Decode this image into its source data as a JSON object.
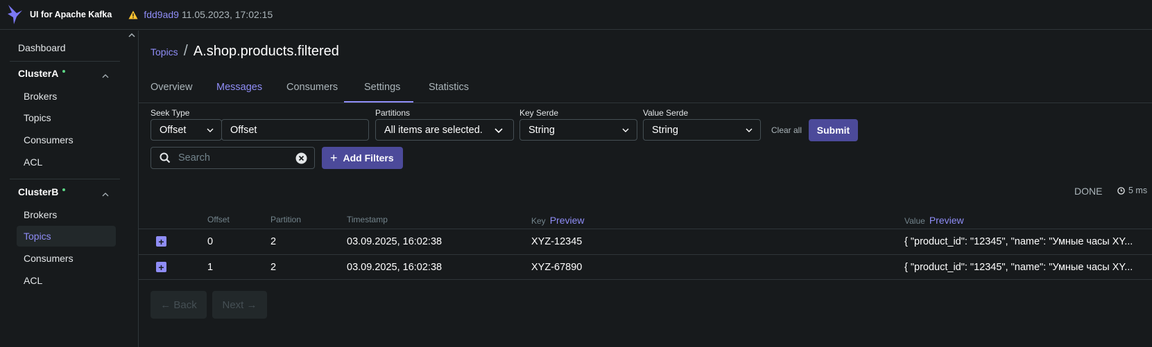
{
  "app": {
    "name": "UI for Apache Kafka",
    "commit": "fdd9ad9",
    "build_date": "11.05.2023, 17:02:15",
    "accent_color": "#8f8df7",
    "button_color": "#4c4a9a",
    "warning_color": "#ffc430",
    "online_dot_color": "#5cd685"
  },
  "sidebar": {
    "dashboard": "Dashboard",
    "clusters": [
      {
        "name": "ClusterA",
        "items": [
          "Brokers",
          "Topics",
          "Consumers",
          "ACL"
        ]
      },
      {
        "name": "ClusterB",
        "items": [
          "Brokers",
          "Topics",
          "Consumers",
          "ACL"
        ],
        "active_item": "Topics"
      }
    ]
  },
  "breadcrumb": {
    "parent": "Topics",
    "separator": "/",
    "title": "A.shop.products.filtered"
  },
  "tabs": [
    {
      "label": "Overview"
    },
    {
      "label": "Messages",
      "active": true
    },
    {
      "label": "Consumers"
    },
    {
      "label": "Settings"
    },
    {
      "label": "Statistics"
    }
  ],
  "filters": {
    "seek_type_label": "Seek Type",
    "seek_type_value": "Offset",
    "seek_input_value": "Offset",
    "partitions_label": "Partitions",
    "partitions_value": "All items are selected.",
    "key_serde_label": "Key Serde",
    "key_serde_value": "String",
    "value_serde_label": "Value Serde",
    "value_serde_value": "String",
    "clear_all": "Clear all",
    "submit": "Submit",
    "search_placeholder": "Search",
    "add_filters": "Add Filters"
  },
  "status": {
    "state": "DONE",
    "elapsed": "5 ms"
  },
  "table": {
    "headers": {
      "offset": "Offset",
      "partition": "Partition",
      "timestamp": "Timestamp",
      "key": "Key",
      "value": "Value",
      "preview": "Preview"
    },
    "rows": [
      {
        "offset": "0",
        "partition": "2",
        "timestamp": "03.09.2025, 16:02:38",
        "key": "XYZ-12345",
        "value": "{ \"product_id\": \"12345\", \"name\": \"Умные часы XY..."
      },
      {
        "offset": "1",
        "partition": "2",
        "timestamp": "03.09.2025, 16:02:38",
        "key": "XYZ-67890",
        "value": "{ \"product_id\": \"12345\", \"name\": \"Умные часы XY..."
      }
    ]
  },
  "pagination": {
    "back": "← Back",
    "next": "Next →"
  }
}
